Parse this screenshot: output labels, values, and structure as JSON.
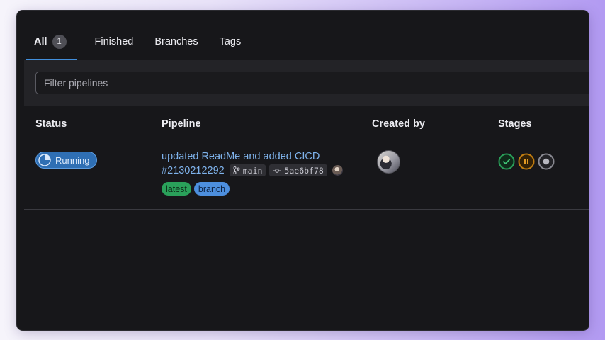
{
  "tabs": [
    {
      "label": "All",
      "count": "1",
      "active": true
    },
    {
      "label": "Finished"
    },
    {
      "label": "Branches"
    },
    {
      "label": "Tags"
    }
  ],
  "filter": {
    "placeholder": "Filter pipelines"
  },
  "table": {
    "headers": {
      "status": "Status",
      "pipeline": "Pipeline",
      "created_by": "Created by",
      "stages": "Stages"
    },
    "rows": [
      {
        "status": "Running",
        "title": "updated ReadMe and added CICD",
        "id": "#2130212292",
        "branch": "main",
        "commit": "5ae6bf78",
        "labels": [
          "latest",
          "branch"
        ],
        "stages": [
          "passed",
          "paused",
          "pending"
        ]
      }
    ]
  },
  "colors": {
    "accent": "#428fdc",
    "running": "#2f6fb4",
    "passed": "#2aa05a",
    "paused": "#c17d10",
    "pending": "#8a8a92"
  },
  "icons": {
    "status": "running-spinner-icon",
    "branch": "git-branch-icon",
    "commit": "git-commit-icon",
    "stage_passed": "check-circle-icon",
    "stage_paused": "pause-circle-icon",
    "stage_pending": "pending-circle-icon"
  }
}
